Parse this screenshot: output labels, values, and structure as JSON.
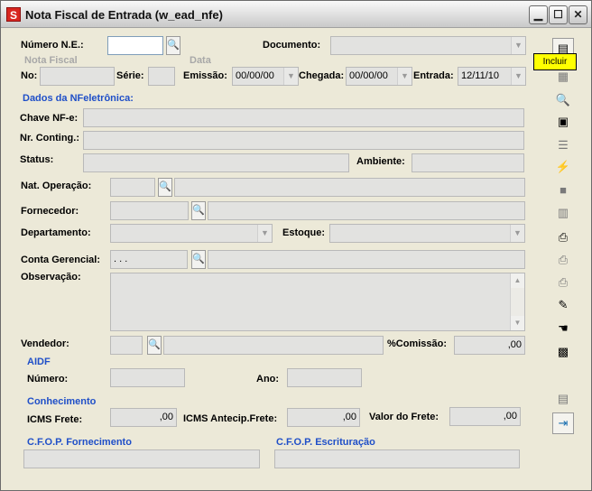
{
  "window": {
    "title": "Nota Fiscal de Entrada (w_ead_nfe)",
    "app_icon_letter": "S",
    "minimize_glyph": "▁",
    "maximize_glyph": "☐",
    "close_glyph": "✕"
  },
  "tooltip": "Incluir",
  "header": {
    "numero_ne_label": "Número N.E.:",
    "numero_ne_value": "",
    "documento_label": "Documento:",
    "documento_value": "",
    "nota_fiscal_group": "Nota Fiscal",
    "data_group": "Data",
    "no_label": "No:",
    "no_value": "",
    "serie_label": "Série:",
    "serie_value": "",
    "emissao_label": "Emissão:",
    "emissao_value": "00/00/00",
    "chegada_label": "Chegada:",
    "chegada_value": "00/00/00",
    "entrada_label": "Entrada:",
    "entrada_value": "12/11/10"
  },
  "nfe": {
    "section": "Dados da NFeletrônica:",
    "chave_label": "Chave NF-e:",
    "chave_value": "",
    "conting_label": "Nr. Conting.:",
    "conting_value": "",
    "status_label": "Status:",
    "status_value": "",
    "ambiente_label": "Ambiente:",
    "ambiente_value": ""
  },
  "main": {
    "nat_operacao_label": "Nat. Operação:",
    "nat_operacao_code": "",
    "nat_operacao_desc": "",
    "fornecedor_label": "Fornecedor:",
    "fornecedor_code": "",
    "fornecedor_desc": "",
    "departamento_label": "Departamento:",
    "departamento_value": "",
    "estoque_label": "Estoque:",
    "estoque_value": "",
    "conta_gerencial_label": "Conta Gerencial:",
    "conta_gerencial_code": ". . .",
    "conta_gerencial_desc": "",
    "observacao_label": "Observação:",
    "observacao_value": "",
    "vendedor_label": "Vendedor:",
    "vendedor_code": "",
    "vendedor_desc": "",
    "comissao_label": "%Comissão:",
    "comissao_value": ",00"
  },
  "aidf": {
    "section": "AIDF",
    "numero_label": "Número:",
    "numero_value": "",
    "ano_label": "Ano:",
    "ano_value": ""
  },
  "conhecimento": {
    "section": "Conhecimento",
    "icms_frete_label": "ICMS Frete:",
    "icms_frete_value": ",00",
    "icms_antecip_label": "ICMS Antecip.Frete:",
    "icms_antecip_value": ",00",
    "valor_frete_label": "Valor do Frete:",
    "valor_frete_value": ",00"
  },
  "cfop": {
    "fornecimento_section": "C.F.O.P. Fornecimento",
    "fornecimento_value": "",
    "escrituracao_section": "C.F.O.P. Escrituração",
    "escrituracao_value": ""
  },
  "toolbar_icons": {
    "incluir": "incluir-icon",
    "alterar": "table-edit-icon",
    "consultar": "search-document-icon",
    "itens": "items-icon",
    "lista": "list-icon",
    "processar": "lightning-icon",
    "gravar": "save-icon",
    "excluir": "trash-icon",
    "imprimir_doc": "print-document-icon",
    "imprimir": "printer-icon",
    "imprimir2": "printer-icon",
    "editar": "edit-icon",
    "ajuda": "hand-icon",
    "calculadora": "calculator-icon",
    "inserir_linha": "insert-row-icon",
    "sair": "exit-icon"
  }
}
